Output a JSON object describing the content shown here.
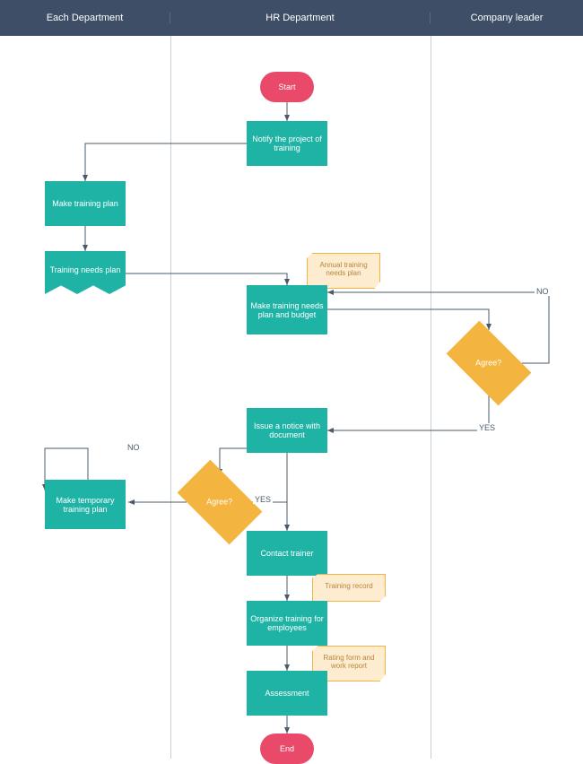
{
  "lanes": {
    "l1": "Each Department",
    "l2": "HR Department",
    "l3": "Company leader"
  },
  "nodes": {
    "start": "Start",
    "end": "End",
    "notify": "Notify the project of training",
    "make_plan": "Make training plan",
    "needs_plan": "Training needs plan",
    "make_needs_budget": "Make training needs plan and budget",
    "agree1": "Agree?",
    "issue_notice": "Issue a notice with document",
    "agree2": "Agree?",
    "make_temp": "Make temporary training plan",
    "contact": "Contact trainer",
    "organize": "Organize training for employees",
    "assessment": "Assessment"
  },
  "annotations": {
    "annual": "Annual training needs plan",
    "record": "Training record",
    "rating": "Rating form and work report"
  },
  "edges": {
    "no": "NO",
    "yes": "YES"
  }
}
